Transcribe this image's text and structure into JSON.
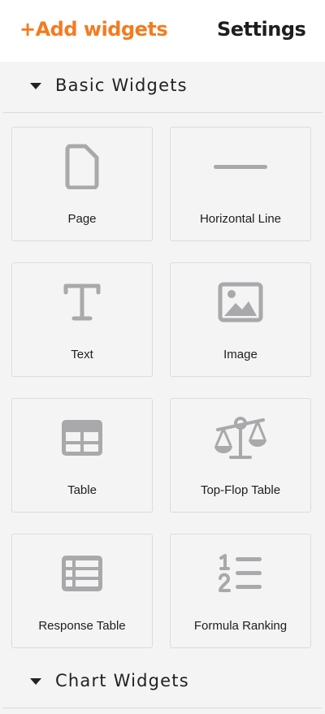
{
  "tabs": {
    "add_widgets": "+Add widgets",
    "settings": "Settings"
  },
  "sections": {
    "basic": {
      "title": "Basic Widgets"
    },
    "chart": {
      "title": "Chart Widgets"
    }
  },
  "widgets": [
    {
      "label": "Page",
      "icon": "page-icon"
    },
    {
      "label": "Horizontal Line",
      "icon": "horizontal-line-icon"
    },
    {
      "label": "Text",
      "icon": "text-icon"
    },
    {
      "label": "Image",
      "icon": "image-icon"
    },
    {
      "label": "Table",
      "icon": "table-icon"
    },
    {
      "label": "Top-Flop Table",
      "icon": "scale-icon"
    },
    {
      "label": "Response Table",
      "icon": "response-table-icon"
    },
    {
      "label": "Formula Ranking",
      "icon": "ordered-list-icon"
    }
  ],
  "colors": {
    "accent": "#f47b20",
    "icon": "#a9a9ab",
    "panel_bg": "#f4f4f5"
  }
}
